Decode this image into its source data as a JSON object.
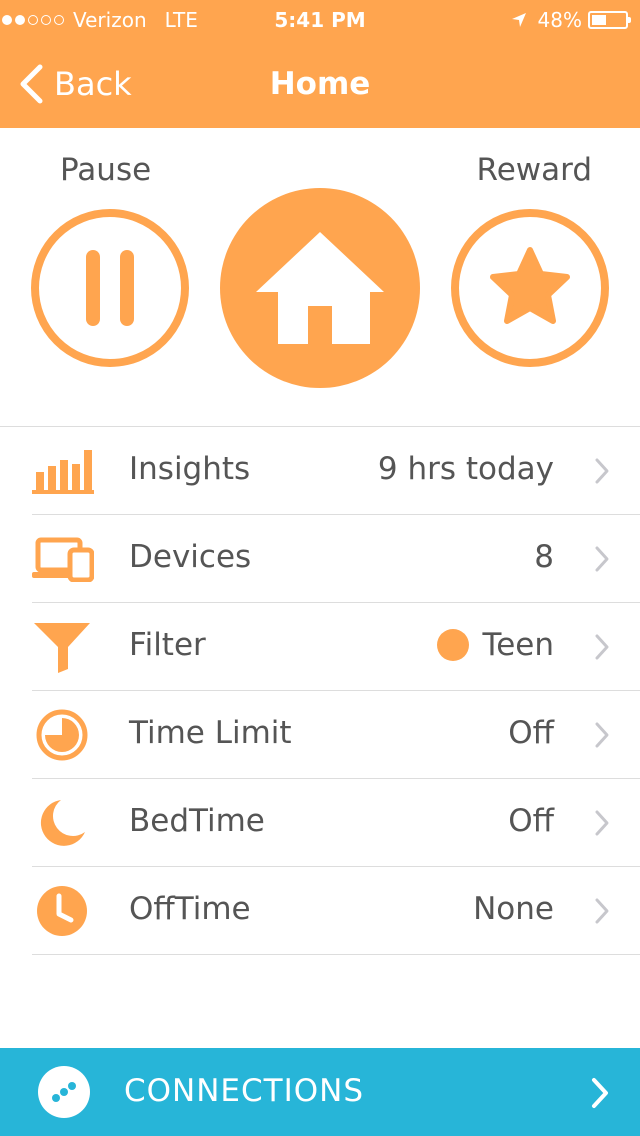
{
  "status_bar": {
    "carrier": "Verizon",
    "network": "LTE",
    "time": "5:41 PM",
    "battery": "48%",
    "battery_level": 0.48
  },
  "nav": {
    "back_label": "Back",
    "title": "Home"
  },
  "controls": {
    "pause_label": "Pause",
    "reward_label": "Reward"
  },
  "list": [
    {
      "label": "Insights",
      "value": "9 hrs today",
      "icon": "bar-chart-icon"
    },
    {
      "label": "Devices",
      "value": "8",
      "icon": "devices-icon"
    },
    {
      "label": "Filter",
      "value": "Teen",
      "icon": "filter-icon"
    },
    {
      "label": "Time Limit",
      "value": "Off",
      "icon": "time-limit-icon"
    },
    {
      "label": "BedTime",
      "value": "Off",
      "icon": "moon-icon"
    },
    {
      "label": "OffTime",
      "value": "None",
      "icon": "clock-icon"
    }
  ],
  "footer": {
    "label": "CONNECTIONS"
  },
  "colors": {
    "accent": "#FFA54F",
    "footer": "#27B5D8",
    "text": "#555555",
    "chevron": "#c7c7cc"
  }
}
